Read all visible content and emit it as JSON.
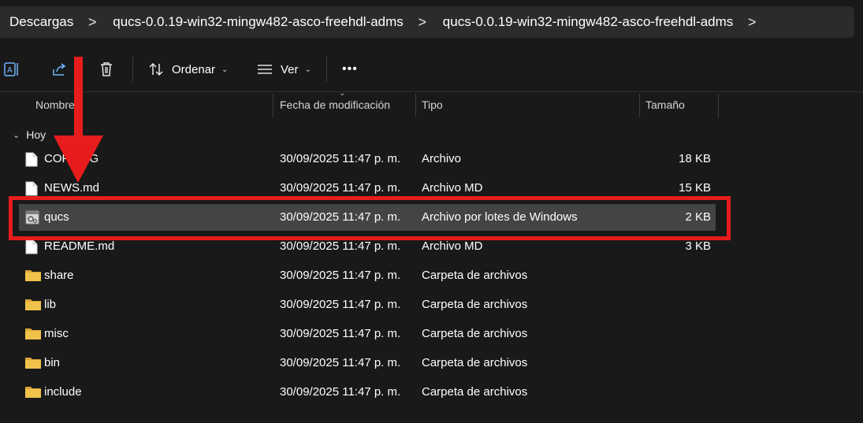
{
  "breadcrumb": {
    "items": [
      "Descargas",
      "qucs-0.0.19-win32-mingw482-asco-freehdl-adms",
      "qucs-0.0.19-win32-mingw482-asco-freehdl-adms"
    ],
    "separator": ">",
    "trailing": ">"
  },
  "toolbar": {
    "sort_label": "Ordenar",
    "view_label": "Ver",
    "more_label": "•••",
    "chevron": "⌄"
  },
  "columns": {
    "name": "Nombre",
    "modified": "Fecha de modificación",
    "type": "Tipo",
    "size": "Tamaño"
  },
  "group": {
    "label": "Hoy",
    "chevron": "⌄"
  },
  "files": [
    {
      "name": "COPYING",
      "modified": "30/09/2025 11:47 p. m.",
      "type": "Archivo",
      "size": "18 KB",
      "icon": "file-icon",
      "selected": false
    },
    {
      "name": "NEWS.md",
      "modified": "30/09/2025 11:47 p. m.",
      "type": "Archivo MD",
      "size": "15 KB",
      "icon": "file-icon",
      "selected": false
    },
    {
      "name": "qucs",
      "modified": "30/09/2025 11:47 p. m.",
      "type": "Archivo por lotes de Windows",
      "size": "2 KB",
      "icon": "batch-file-icon",
      "selected": true
    },
    {
      "name": "README.md",
      "modified": "30/09/2025 11:47 p. m.",
      "type": "Archivo MD",
      "size": "3 KB",
      "icon": "file-icon",
      "selected": false
    },
    {
      "name": "share",
      "modified": "30/09/2025 11:47 p. m.",
      "type": "Carpeta de archivos",
      "size": "",
      "icon": "folder-icon",
      "selected": false
    },
    {
      "name": "lib",
      "modified": "30/09/2025 11:47 p. m.",
      "type": "Carpeta de archivos",
      "size": "",
      "icon": "folder-icon",
      "selected": false
    },
    {
      "name": "misc",
      "modified": "30/09/2025 11:47 p. m.",
      "type": "Carpeta de archivos",
      "size": "",
      "icon": "folder-icon",
      "selected": false
    },
    {
      "name": "bin",
      "modified": "30/09/2025 11:47 p. m.",
      "type": "Carpeta de archivos",
      "size": "",
      "icon": "folder-icon",
      "selected": false
    },
    {
      "name": "include",
      "modified": "30/09/2025 11:47 p. m.",
      "type": "Carpeta de archivos",
      "size": "",
      "icon": "folder-icon",
      "selected": false
    }
  ],
  "colors": {
    "background": "#191919",
    "selected_row": "#444444",
    "annotation_red": "#e81c1c",
    "folder_yellow": "#f0c24a"
  }
}
